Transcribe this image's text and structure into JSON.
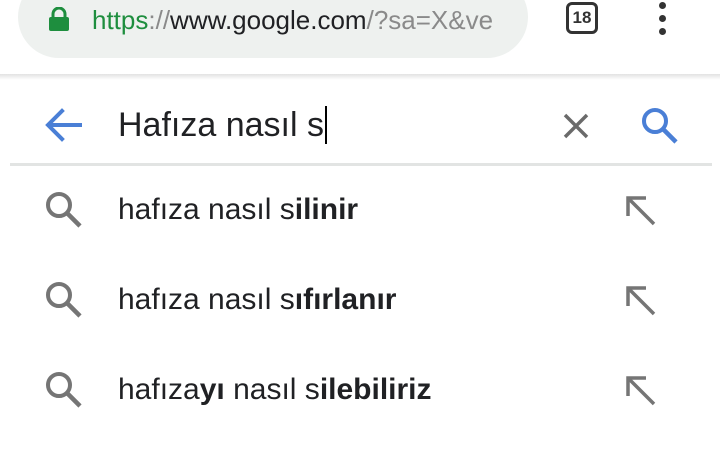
{
  "browser": {
    "url_scheme": "https",
    "url_sep": "://",
    "url_host": "www.google.com",
    "url_rest": "/?sa=X&ve",
    "tab_count": "18"
  },
  "search": {
    "query": "Hafıza nasıl s"
  },
  "suggestions": [
    {
      "parts": [
        {
          "text": "hafıza nasıl s",
          "bold": false
        },
        {
          "text": "ilinir",
          "bold": true
        }
      ]
    },
    {
      "parts": [
        {
          "text": "hafıza nasıl s",
          "bold": false
        },
        {
          "text": "ıfırlanır",
          "bold": true
        }
      ]
    },
    {
      "parts": [
        {
          "text": "hafıza",
          "bold": false
        },
        {
          "text": "yı",
          "bold": true
        },
        {
          "text": " nasıl s",
          "bold": false
        },
        {
          "text": "ilebiliriz",
          "bold": true
        }
      ]
    }
  ],
  "colors": {
    "accent_blue": "#4a7fd6",
    "secure_green": "#1e8e3e",
    "icon_gray": "#757575"
  },
  "icons": {
    "lock": "lock-icon",
    "back": "arrow-back-icon",
    "clear": "close-icon",
    "search": "search-icon",
    "suggestion": "search-icon",
    "fill": "arrow-up-left-icon",
    "menu": "more-vert-icon"
  }
}
